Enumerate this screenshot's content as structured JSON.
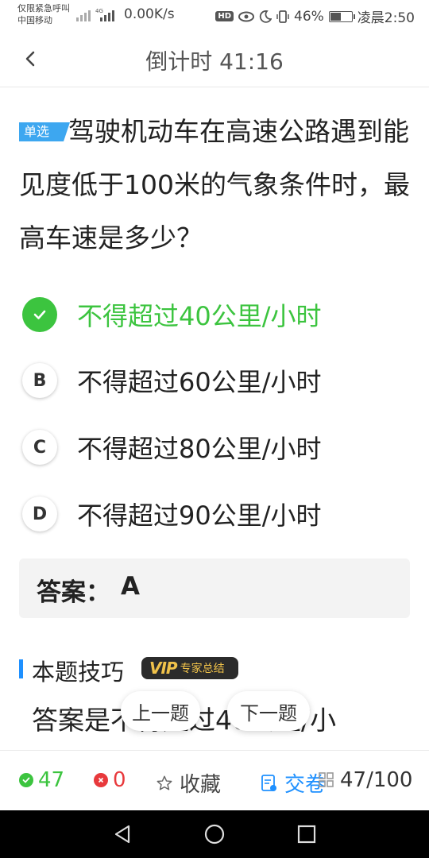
{
  "status_bar": {
    "carrier_line1": "仅限紧急呼叫",
    "carrier_line2": "中国移动",
    "network_speed": "0.00K/s",
    "hd_label": "HD",
    "battery_percent": "46%",
    "battery_level": 0.46,
    "time": "凌晨2:50"
  },
  "header": {
    "back_icon": "chevron-left-icon",
    "title": "倒计时 41:16"
  },
  "question": {
    "type_tag": "单选",
    "text": "驾驶机动车在高速公路遇到能见度低于100米的气象条件时，最高车速是多少？"
  },
  "options": [
    {
      "letter": "A",
      "text": "不得超过40公里/小时",
      "selected_correct": true
    },
    {
      "letter": "B",
      "text": "不得超过60公里/小时",
      "selected_correct": false
    },
    {
      "letter": "C",
      "text": "不得超过80公里/小时",
      "selected_correct": false
    },
    {
      "letter": "D",
      "text": "不得超过90公里/小时",
      "selected_correct": false
    }
  ],
  "answer": {
    "label": "答案：",
    "value": "A"
  },
  "tips": {
    "title": "本题技巧",
    "vip_logo": "VIP",
    "vip_text": "专家总结",
    "text": "答案是不得超过40公里/小"
  },
  "navigation": {
    "prev_label": "上一题",
    "next_label": "下一题"
  },
  "toolbar": {
    "correct_count": "47",
    "wrong_count": "0",
    "favorite_label": "收藏",
    "submit_label": "交卷",
    "progress": "47/100"
  },
  "colors": {
    "correct": "#3cc43f",
    "wrong": "#e8393c",
    "accent_blue": "#1e90ff",
    "tag_blue": "#3da7f0",
    "vip_gold": "#f0c24a"
  }
}
